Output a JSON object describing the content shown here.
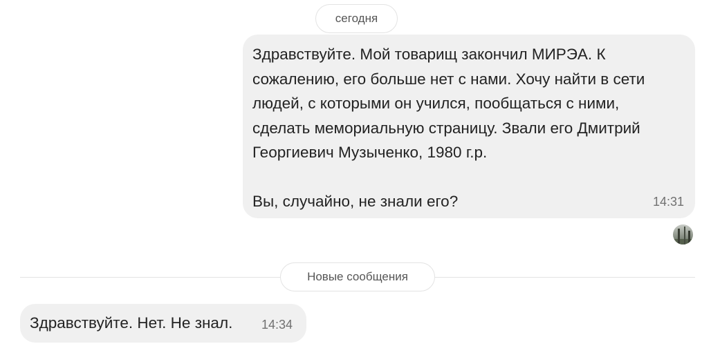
{
  "chat": {
    "date_separator": "сегодня",
    "new_messages_separator": "Новые сообщения",
    "messages": [
      {
        "direction": "outgoing",
        "text": "Здравствуйте. Мой товарищ закончил МИРЭА. К\nсожалению, его больше нет с нами. Хочу найти в сети\nлюдей, с которыми он учился, пообщаться с ними,\nсделать мемориальную страницу. Звали его Дмитрий\nГеоргиевич Музыченко, 1980 г.р.\n\nВы, случайно, не знали его?",
        "time": "14:31"
      },
      {
        "direction": "incoming",
        "text": "Здравствуйте. Нет. Не знал.",
        "time": "14:34"
      }
    ]
  }
}
